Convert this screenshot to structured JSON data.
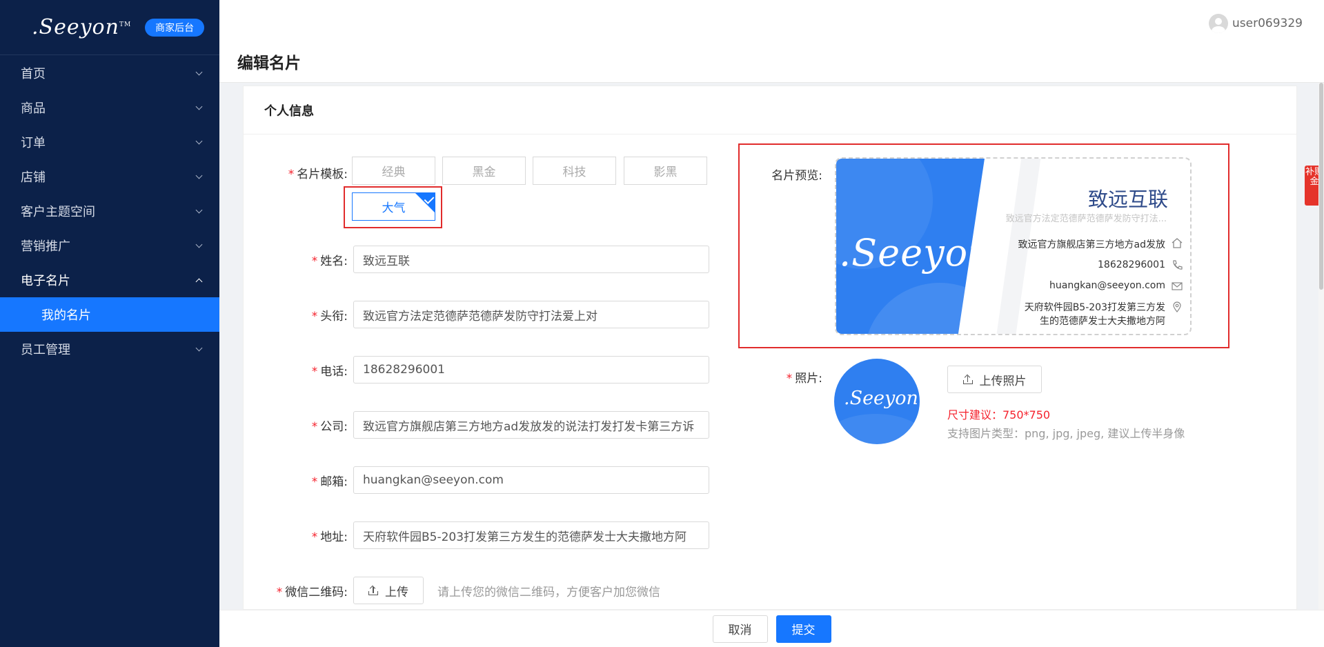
{
  "brand": {
    "logo": ".Seeyon",
    "tm": "TM",
    "badge": "商家后台"
  },
  "sidebar": {
    "items": [
      {
        "label": "首页"
      },
      {
        "label": "商品"
      },
      {
        "label": "订单"
      },
      {
        "label": "店铺"
      },
      {
        "label": "客户主题空间"
      },
      {
        "label": "营销推广"
      },
      {
        "label": "电子名片"
      },
      {
        "label": "员工管理"
      }
    ],
    "sub_active": "我的名片"
  },
  "header": {
    "page_title": "编辑名片",
    "username": "user069329"
  },
  "section_title": "个人信息",
  "form": {
    "template_label": "名片模板:",
    "templates": [
      "经典",
      "黑金",
      "科技",
      "影黑",
      "大气"
    ],
    "name_label": "姓名:",
    "name_value": "致远互联",
    "title_label": "头衔:",
    "title_value": "致远官方法定范德萨范德萨发防守打法爱上对",
    "phone_label": "电话:",
    "phone_value": "18628296001",
    "company_label": "公司:",
    "company_value": "致远官方旗舰店第三方地方ad发放发的说法打发打发卡第三方诉",
    "email_label": "邮箱:",
    "email_value": "huangkan@seeyon.com",
    "address_label": "地址:",
    "address_value": "天府软件园B5-203打发第三方发生的范德萨发士大夫撒地方阿",
    "wechat_label": "微信二维码:",
    "wechat_upload": "上传",
    "wechat_hint": "请上传您的微信二维码，方便客户加您微信"
  },
  "preview": {
    "label": "名片预览:",
    "logo": ".Seeyon",
    "name": "致远互联",
    "title": "致远官方法定范德萨范德萨发防守打法...",
    "company": "致远官方旗舰店第三方地方ad发放",
    "phone": "18628296001",
    "email": "huangkan@seeyon.com",
    "address_line1": "天府软件园B5-203打发第三方发",
    "address_line2": "生的范德萨发士大夫撒地方阿"
  },
  "photo": {
    "label": "照片:",
    "logo": ".Seeyon",
    "upload": "上传照片",
    "size_hint": "尺寸建议：750*750",
    "type_hint": "支持图片类型：png, jpg, jpeg, 建议上传半身像"
  },
  "footer": {
    "cancel": "取消",
    "submit": "提交"
  },
  "float_tag": "补贴金",
  "colors": {
    "sidebar_bg": "#0c2149",
    "accent": "#1677ff",
    "required": "#f5222d",
    "highlight_box": "#e12b2b"
  }
}
